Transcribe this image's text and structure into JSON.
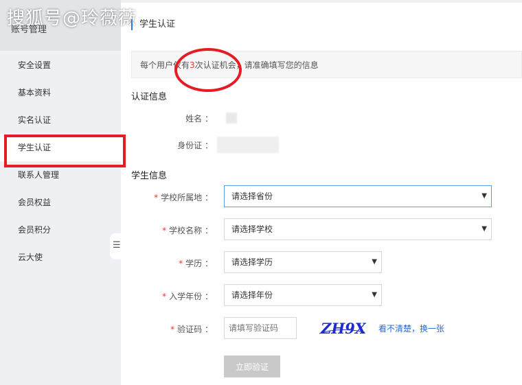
{
  "watermark": "搜狐号@玲薇薇",
  "sidebar": {
    "header": "账号管理",
    "items": [
      {
        "label": "安全设置"
      },
      {
        "label": "基本资料"
      },
      {
        "label": "实名认证"
      },
      {
        "label": "学生认证"
      },
      {
        "label": "联系人管理"
      },
      {
        "label": "会员权益"
      },
      {
        "label": "会员积分"
      },
      {
        "label": "云大使"
      }
    ],
    "collapse_glyph": "☰"
  },
  "page_title": "学生认证",
  "notice": {
    "prefix": "每个用户仅有",
    "count": "3",
    "middle": "次认证机会",
    "suffix": "，请准确填写您的信息"
  },
  "auth_info": {
    "title": "认证信息",
    "name_label": "姓名 ：",
    "id_label": "身份证 ："
  },
  "student_info": {
    "title": "学生信息",
    "required_mark": "*",
    "school_region": {
      "label": "学校所属地 ：",
      "value": "请选择省份"
    },
    "school_name": {
      "label": "学校名称 ：",
      "value": "请选择学校"
    },
    "education": {
      "label": "学历 ：",
      "value": "请选择学历"
    },
    "enroll_year": {
      "label": "入学年份 ：",
      "value": "请选择年份"
    },
    "captcha": {
      "label": "验证码 ：",
      "placeholder": "请填写验证码",
      "image_text": "ZH9X",
      "refresh": "看不清楚，换一张"
    },
    "submit": "立即验证",
    "arrow_glyph": "▼"
  },
  "colors": {
    "accent": "#ff7a1a",
    "link": "#2a6bd1",
    "required": "#e33333",
    "annotation": "#e51c23"
  }
}
